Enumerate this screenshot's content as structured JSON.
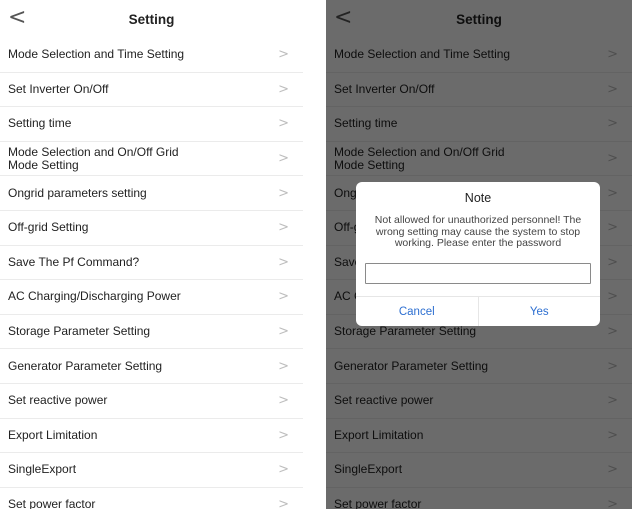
{
  "header": {
    "back_icon": "chevron-left-icon",
    "back_glyph": "<",
    "title": "Setting"
  },
  "chevron_glyph": ">",
  "menu_items": [
    {
      "label": "Mode Selection and Time Setting"
    },
    {
      "label": "Set Inverter On/Off"
    },
    {
      "label": "Setting time"
    },
    {
      "label": "Mode Selection and On/Off Grid\nMode Setting"
    },
    {
      "label": "Ongrid parameters setting"
    },
    {
      "label": "Off-grid Setting"
    },
    {
      "label": "Save The Pf Command?"
    },
    {
      "label": "AC Charging/Discharging Power"
    },
    {
      "label": "Storage Parameter Setting"
    },
    {
      "label": "Generator Parameter Setting"
    },
    {
      "label": "Set reactive power"
    },
    {
      "label": "Export Limitation"
    },
    {
      "label": "SingleExport"
    },
    {
      "label": "Set power factor"
    }
  ],
  "dialog": {
    "title": "Note",
    "message": "Not allowed for unauthorized personnel! The wrong setting may cause the system to stop working. Please enter the password",
    "password_value": "",
    "cancel_label": "Cancel",
    "yes_label": "Yes"
  },
  "colors": {
    "accent": "#2d6fd1",
    "overlay": "#000000"
  }
}
